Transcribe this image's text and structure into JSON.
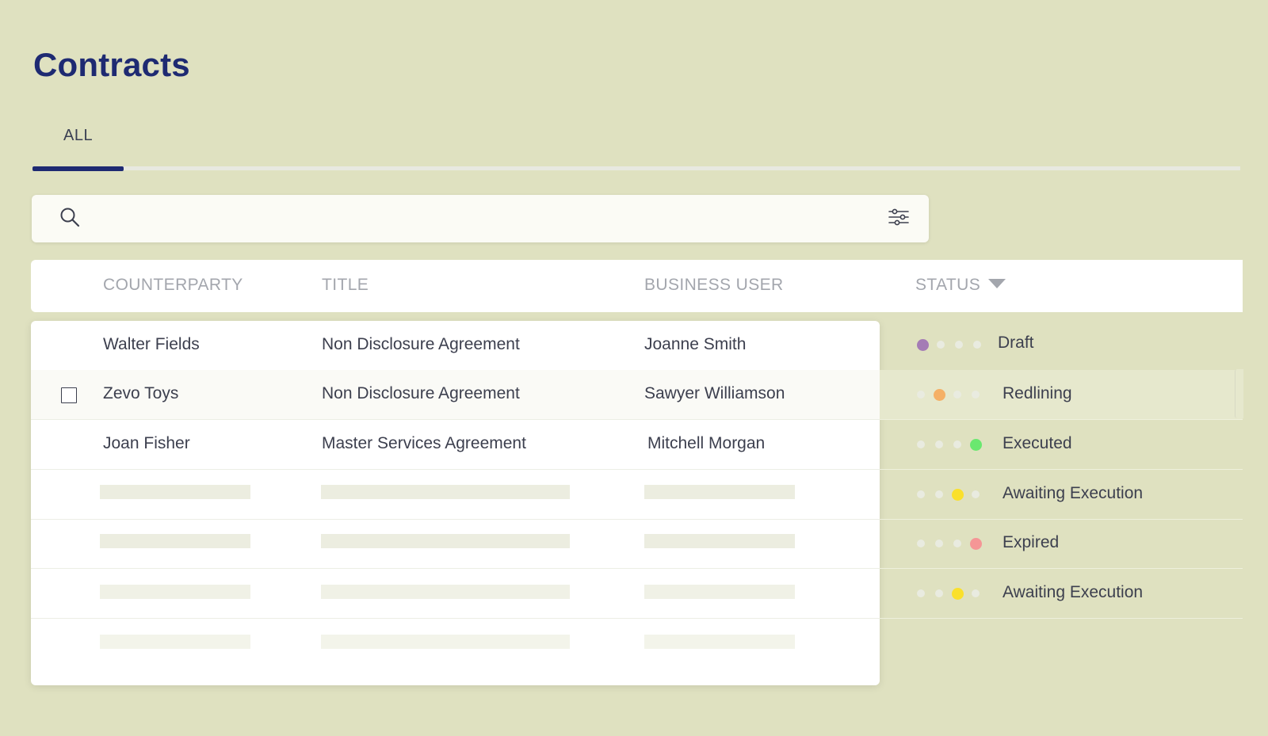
{
  "page": {
    "title": "Contracts"
  },
  "tabs": [
    {
      "label": "ALL",
      "active": true
    }
  ],
  "search": {
    "value": "",
    "placeholder": "",
    "icon": "search-icon",
    "filter_icon": "filter-sliders-icon"
  },
  "table": {
    "columns": [
      "COUNTERPARTY",
      "TITLE",
      "BUSINESS USER",
      "STATUS"
    ],
    "sort_indicator": "chevron-down-icon",
    "rows": [
      {
        "counterparty": "Walter Fields",
        "title": "Non Disclosure Agreement",
        "business_user": "Joanne Smith",
        "status": "Draft",
        "status_step": 1
      },
      {
        "counterparty": "Zevo Toys",
        "title": "Non Disclosure Agreement",
        "business_user": "Sawyer Williamson",
        "status": "Redlining",
        "status_step": 2
      },
      {
        "counterparty": "Joan Fisher",
        "title": "Master Services Agreement",
        "business_user": "Mitchell Morgan",
        "status": "Executed",
        "status_step": 4
      },
      {
        "status": "Awaiting Execution",
        "status_step": 3
      },
      {
        "status": "Expired",
        "status_step": 4
      },
      {
        "status": "Awaiting Execution",
        "status_step": 3
      }
    ]
  },
  "status_colors": {
    "Draft": "#a47cb5",
    "Redlining": "#f5b066",
    "Executed": "#6ae86f",
    "Awaiting Execution": "#fae02b",
    "Expired": "#f59696",
    "inactive": "#e9ebe0"
  },
  "theme": {
    "accent": "#1e2a72",
    "background": "#dfe1c0"
  }
}
